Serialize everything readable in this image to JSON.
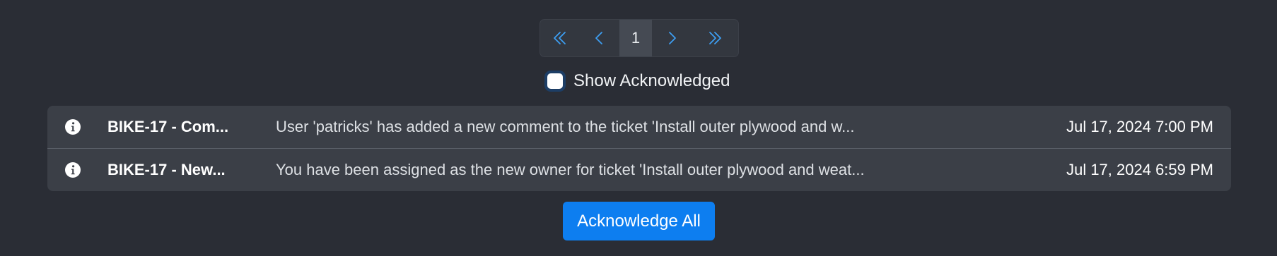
{
  "pagination": {
    "first_icon": "double-chevron-left-icon",
    "prev_icon": "chevron-left-icon",
    "current_page": "1",
    "next_icon": "chevron-right-icon",
    "last_icon": "double-chevron-right-icon",
    "accent_color": "#3d9ef2"
  },
  "filter": {
    "show_acknowledged_label": "Show Acknowledged",
    "show_acknowledged_checked": false
  },
  "notifications": [
    {
      "icon": "info-icon",
      "title": "BIKE-17 - Com...",
      "message": "User 'patricks' has added a new comment to the ticket 'Install outer plywood and w...",
      "time": "Jul 17, 2024 7:00 PM"
    },
    {
      "icon": "info-icon",
      "title": "BIKE-17 - New...",
      "message": "You have been assigned as the new owner for ticket 'Install outer plywood and weat...",
      "time": "Jul 17, 2024 6:59 PM"
    }
  ],
  "actions": {
    "acknowledge_all_label": "Acknowledge All",
    "button_color": "#0d7ef0"
  }
}
